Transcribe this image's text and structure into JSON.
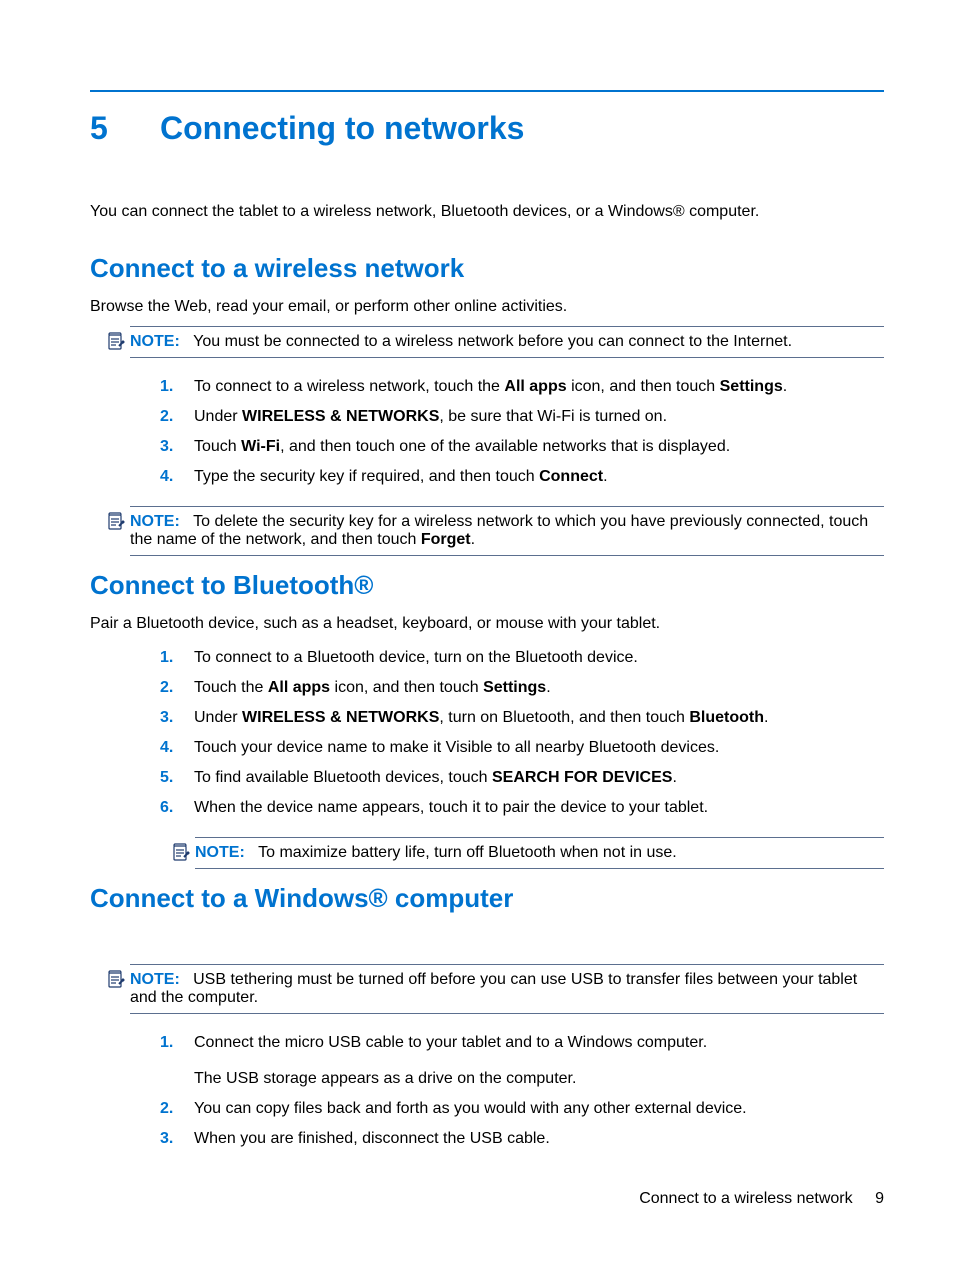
{
  "chapter_number": "5",
  "chapter_title": "Connecting to networks",
  "intro": "You can connect the tablet to a wireless network, Bluetooth devices, or a Windows® computer.",
  "sections": {
    "wireless": {
      "heading": "Connect to a wireless network",
      "lead": "Browse the Web, read your email, or perform other online activities.",
      "note1_label": "NOTE:",
      "note1_text": "You must be connected to a wireless network before you can connect to the Internet.",
      "steps": [
        "To connect to a wireless network, touch the <b>All apps</b> icon, and then touch <b>Settings</b>.",
        "Under <b>WIRELESS & NETWORKS</b>, be sure that Wi-Fi is turned on.",
        "Touch <b>Wi-Fi</b>, and then touch one of the available networks that is displayed.",
        "Type the security key if required, and then touch <b>Connect</b>."
      ],
      "note2_label": "NOTE:",
      "note2_text": "To delete the security key for a wireless network to which you have previously connected, touch the name of the network, and then touch <b>Forget</b>."
    },
    "bluetooth": {
      "heading": "Connect to Bluetooth®",
      "lead": "Pair a Bluetooth device, such as a headset, keyboard, or mouse with your tablet.",
      "steps": [
        "To connect to a Bluetooth device, turn on the Bluetooth device.",
        "Touch the <b>All apps</b> icon, and then touch <b>Settings</b>.",
        "Under <b>WIRELESS & NETWORKS</b>, turn on Bluetooth, and then touch <b>Bluetooth</b>.",
        "Touch your device name to make it Visible to all nearby Bluetooth devices.",
        "To find available Bluetooth devices, touch <b>SEARCH FOR DEVICES</b>.",
        "When the device name appears, touch it to pair the device to your tablet."
      ],
      "note_label": "NOTE:",
      "note_text": "To maximize battery life, turn off Bluetooth when not in use."
    },
    "windows": {
      "heading": "Connect to a Windows® computer",
      "note_label": "NOTE:",
      "note_text": "USB tethering must be turned off before you can use USB to transfer files between your tablet and the computer.",
      "steps": [
        "Connect the micro USB cable to your tablet and to a Windows computer.<br><br>The USB storage appears as a drive on the computer.",
        "You can copy files back and forth as you would with any other external device.",
        "When you are finished, disconnect the USB cable."
      ]
    }
  },
  "footer": {
    "text": "Connect to a wireless network",
    "page": "9"
  }
}
